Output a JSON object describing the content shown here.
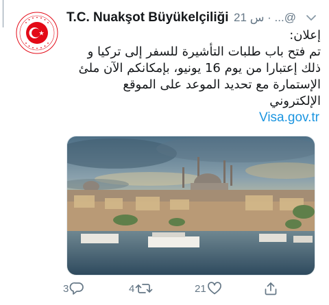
{
  "tweet": {
    "author_name": "T.C. Nuakşot Büyükelçiliği",
    "handle_time": "21 س · ...@",
    "lines": [
      "إعلان:",
      "تم فتح باب طلبات التأشيرة للسفر إلى تركيا و",
      "ذلك إعتبارا من يوم 16 يونيو، بإمكانكم الآن ملئ",
      "الإستمارة مع تحديد الموعد على الموقع",
      "الإلكتروني"
    ],
    "link": "Visa.gov.tr"
  },
  "actions": {
    "reply_count": "3",
    "retweet_count": "4",
    "like_count": "21"
  },
  "icons": {
    "avatar": "embassy-logo-icon",
    "caret": "chevron-down-icon",
    "reply": "reply-icon",
    "retweet": "retweet-icon",
    "like": "heart-icon",
    "share": "share-icon"
  },
  "colors": {
    "text": "#14171a",
    "secondary": "#657786",
    "link": "#1b95e0",
    "logo_red": "#e30a17"
  }
}
